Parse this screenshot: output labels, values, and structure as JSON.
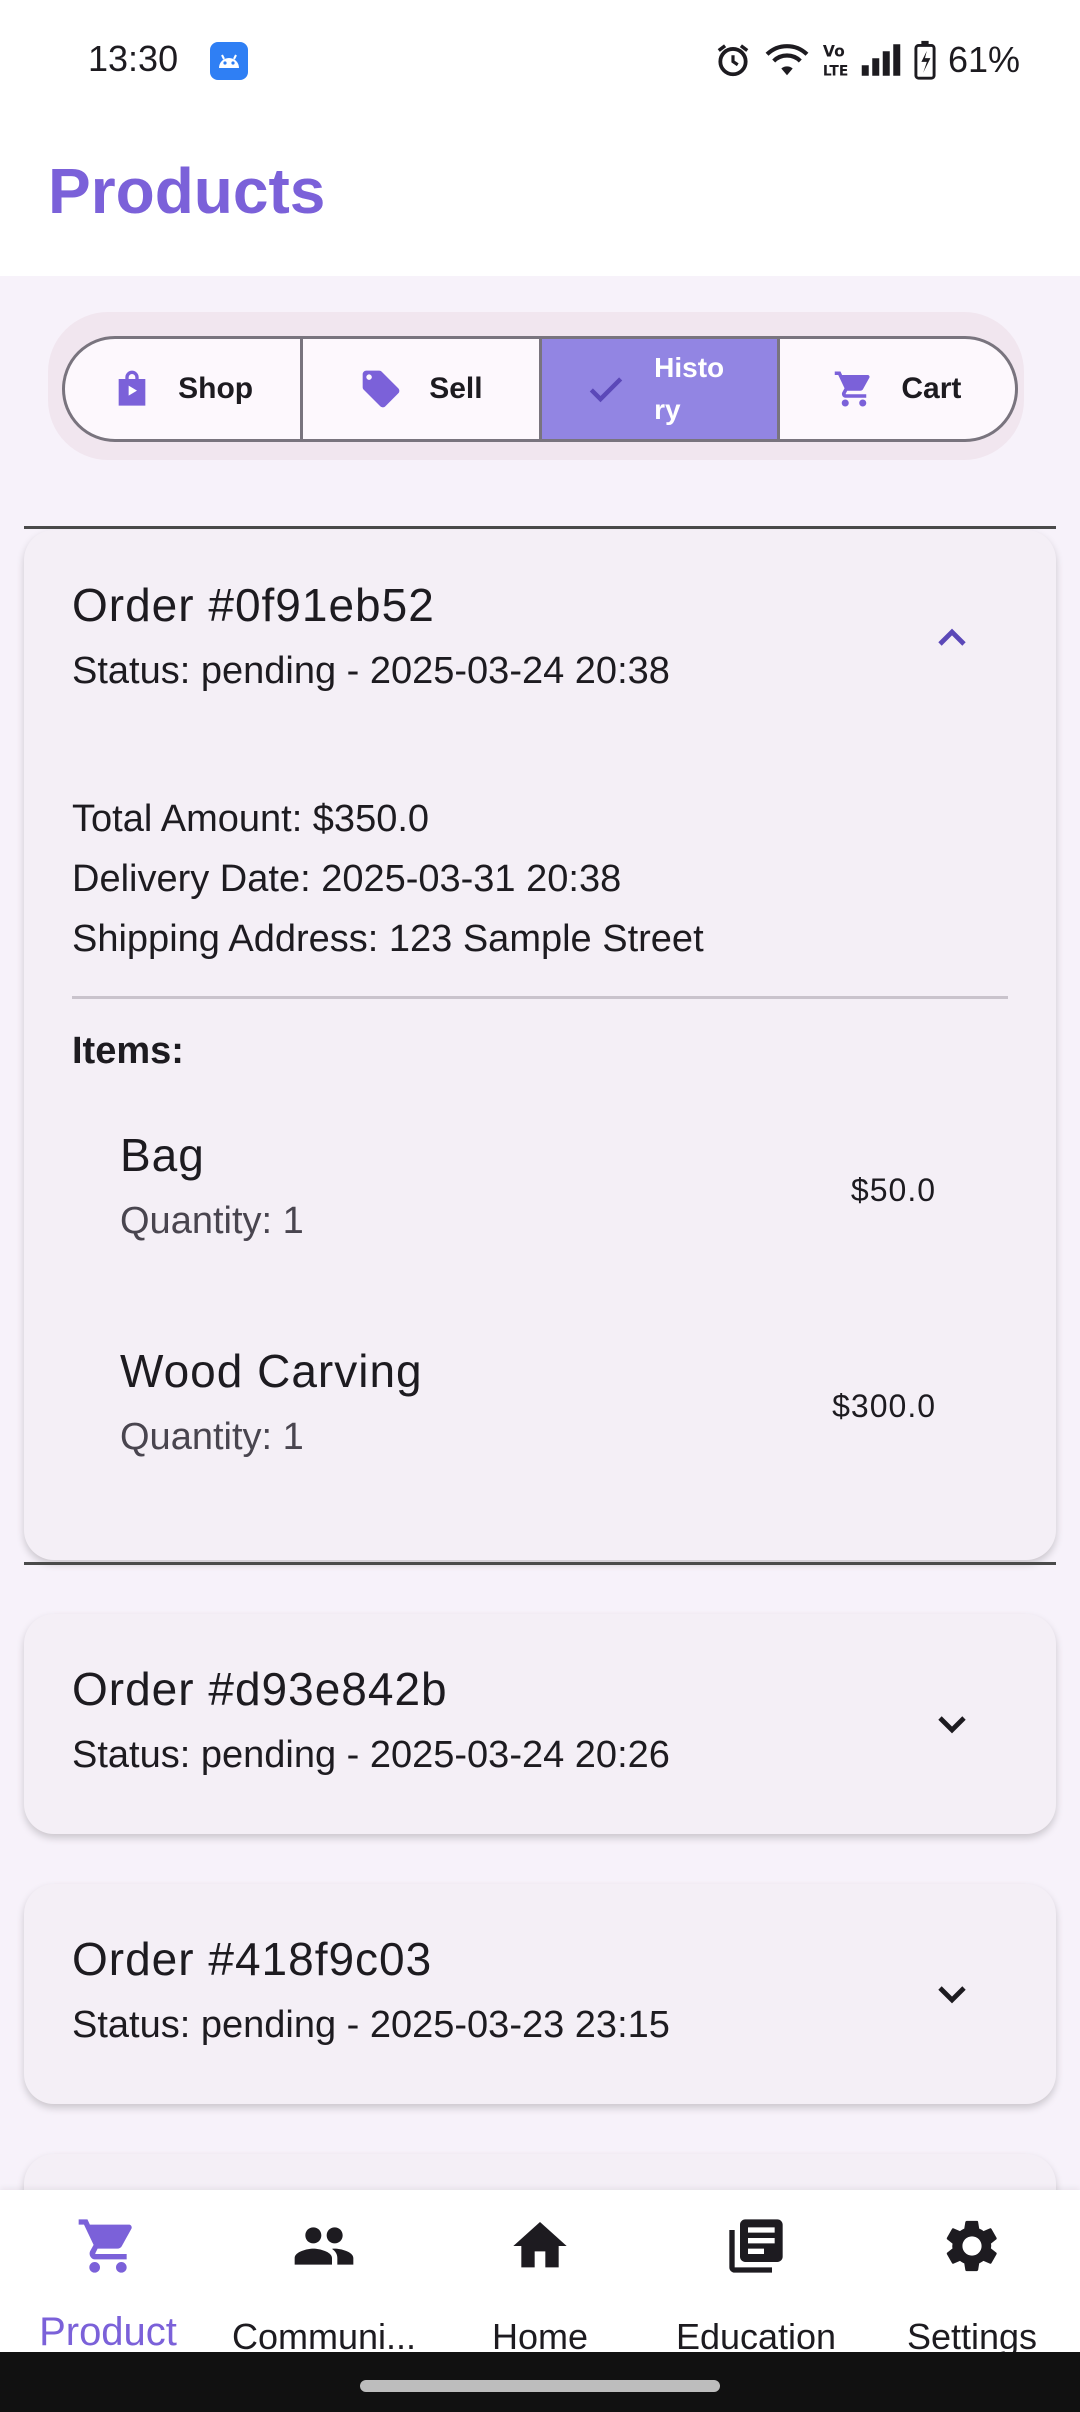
{
  "status_bar": {
    "time": "13:30",
    "battery": "61%",
    "icons": [
      "android-app-icon",
      "alarm-icon",
      "wifi-icon",
      "volte-icon",
      "signal-icon",
      "battery-icon"
    ]
  },
  "appbar": {
    "title": "Products"
  },
  "tabs": [
    {
      "label": "Shop",
      "icon": "shopping-bag-icon",
      "active": false
    },
    {
      "label": "Sell",
      "icon": "tag-icon",
      "active": false
    },
    {
      "label": "History",
      "icon": "check-icon",
      "active": true
    },
    {
      "label": "Cart",
      "icon": "cart-icon",
      "active": false
    }
  ],
  "orders": [
    {
      "title": "Order #0f91eb52",
      "status": "Status: pending - 2025-03-24 20:38",
      "expanded": true,
      "total": "Total Amount: $350.0",
      "delivery": "Delivery Date: 2025-03-31 20:38",
      "address": "Shipping Address: 123 Sample Street",
      "items_label": "Items:",
      "items": [
        {
          "name": "Bag",
          "quantity": "Quantity: 1",
          "price": "$50.0"
        },
        {
          "name": "Wood Carving",
          "quantity": "Quantity: 1",
          "price": "$300.0"
        }
      ]
    },
    {
      "title": "Order #d93e842b",
      "status": "Status: pending - 2025-03-24 20:26",
      "expanded": false
    },
    {
      "title": "Order #418f9c03",
      "status": "Status: pending - 2025-03-23 23:15",
      "expanded": false
    }
  ],
  "bottom_nav": [
    {
      "label": "Product",
      "icon": "cart-icon",
      "active": true
    },
    {
      "label": "Communi...",
      "icon": "people-icon",
      "active": false
    },
    {
      "label": "Home",
      "icon": "home-icon",
      "active": false
    },
    {
      "label": "Education",
      "icon": "library-books-icon",
      "active": false
    },
    {
      "label": "Settings",
      "icon": "gear-icon",
      "active": false
    }
  ],
  "colors": {
    "accent": "#7b61d9",
    "active_tab_bg": "#9285e3",
    "card_bg": "#f4eff6",
    "page_bg": "#f7f2fa"
  }
}
